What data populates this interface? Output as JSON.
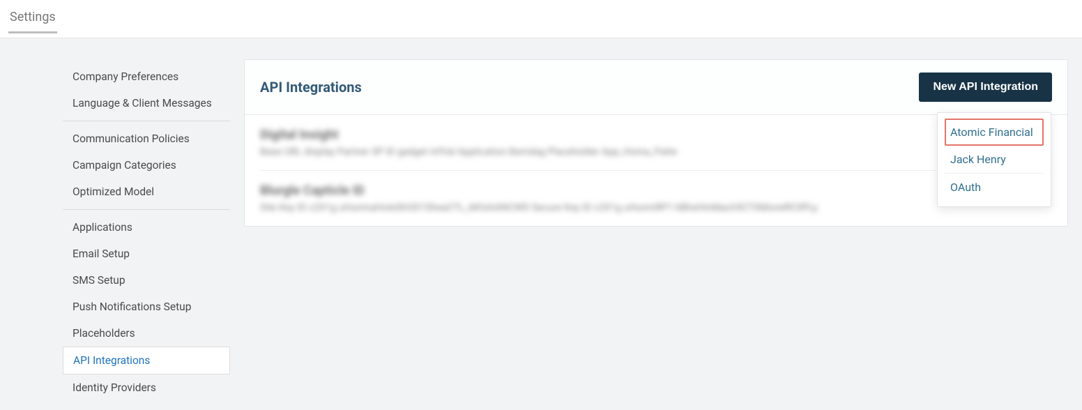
{
  "topbar": {
    "tab_label": "Settings"
  },
  "sidebar": {
    "groups": [
      {
        "items": [
          {
            "label": "Company Preferences"
          },
          {
            "label": "Language & Client Messages"
          }
        ]
      },
      {
        "items": [
          {
            "label": "Communication Policies"
          },
          {
            "label": "Campaign Categories"
          },
          {
            "label": "Optimized Model"
          }
        ]
      },
      {
        "items": [
          {
            "label": "Applications"
          },
          {
            "label": "Email Setup"
          },
          {
            "label": "SMS Setup"
          },
          {
            "label": "Push Notifications Setup"
          },
          {
            "label": "Placeholders"
          },
          {
            "label": "API Integrations",
            "active": true
          },
          {
            "label": "Identity Providers"
          }
        ]
      }
    ]
  },
  "panel": {
    "title": "API Integrations",
    "new_button_label": "New API Integration",
    "rows": [
      {
        "title": "Digital Insight",
        "sub": "Base URL display   Partner SP ID gadget   InfVal   Application Barndag   Placeholder App_Homa_Patte"
      },
      {
        "title": "Blurgle Capticle ID",
        "sub": "Site Key ID c2X1g uHunmaHoleShOD1SheaCTL_MOshANCWD   Secure Key ID c2X1g uHunmRP1 kBheHinMach5CTXMoneRC0PLy"
      }
    ],
    "dropdown_options": [
      {
        "label": "Atomic Financial",
        "highlight": true
      },
      {
        "label": "Jack Henry"
      },
      {
        "label": "OAuth"
      }
    ]
  }
}
